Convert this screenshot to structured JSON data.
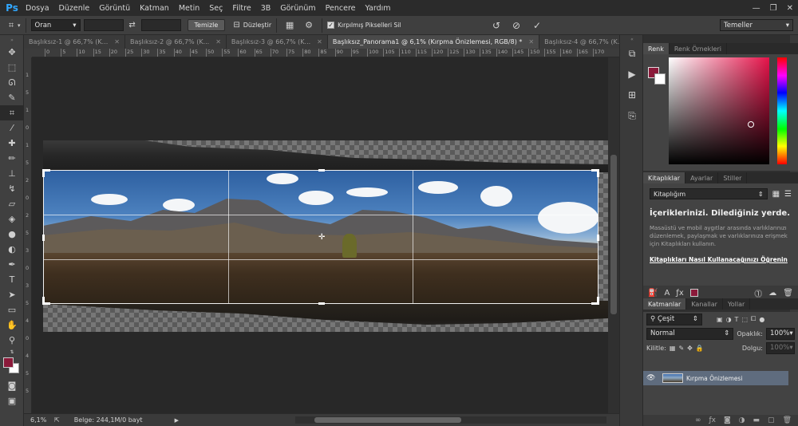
{
  "app": {
    "logo": "Ps",
    "menu": [
      "Dosya",
      "Düzenle",
      "Görüntü",
      "Katman",
      "Metin",
      "Seç",
      "Filtre",
      "3B",
      "Görünüm",
      "Pencere",
      "Yardım"
    ],
    "window_controls": [
      "—",
      "❐",
      "✕"
    ]
  },
  "options_bar": {
    "ratio_dropdown": "Oran",
    "clear_button": "Temizle",
    "straighten_label": "Düzleştir",
    "delete_cropped_label": "Kırpılmış Pikselleri Sil",
    "delete_cropped_checked": true,
    "workspace_dropdown": "Temeller"
  },
  "doc_tabs": [
    {
      "label": "Başlıksız-1 @ 66,7% (K...",
      "active": false
    },
    {
      "label": "Başlıksız-2 @ 66,7% (K...",
      "active": false
    },
    {
      "label": "Başlıksız-3 @ 66,7% (K...",
      "active": false
    },
    {
      "label": "Başlıksız_Panorama1 @ 6,1% (Kırpma Önizlemesi, RGB/8) *",
      "active": true
    },
    {
      "label": "Başlıksız-4 @ 66,7% (K...",
      "active": false
    }
  ],
  "rulers": {
    "top_ticks": [
      "0",
      "5",
      "10",
      "15",
      "20",
      "25",
      "30",
      "35",
      "40",
      "45",
      "50",
      "55",
      "60",
      "65",
      "70",
      "75",
      "80",
      "85",
      "90",
      "95",
      "100",
      "105",
      "110",
      "115",
      "120",
      "125",
      "130",
      "135",
      "140",
      "145",
      "150",
      "155",
      "160",
      "165",
      "170"
    ],
    "left_ticks": [
      "1",
      "5",
      "1",
      "0",
      "1",
      "5",
      "2",
      "0",
      "2",
      "5",
      "3",
      "0",
      "3",
      "5",
      "4",
      "0",
      "4",
      "5",
      "5"
    ]
  },
  "status": {
    "zoom": "6,1%",
    "doc_info": "Belge: 244,1M/0 bayt"
  },
  "color_panel": {
    "tabs": [
      "Renk",
      "Renk Örnekleri"
    ],
    "foreground": "#8b1a3a",
    "background": "#ffffff"
  },
  "library_panel": {
    "tabs": [
      "Kitaplıklar",
      "Ayarlar",
      "Stiller"
    ],
    "select": "Kitaplığım",
    "title": "İçeriklerinizi. Dilediğiniz yerde.",
    "description": "Masaüstü ve mobil aygıtlar arasında varlıklarınızı düzenlemek, paylaşmak ve varlıklarınıza erişmek için Kitaplıkları kullanın.",
    "link": "Kitaplıkları Nasıl Kullanacağınızı Öğrenin"
  },
  "layers_panel": {
    "tabs": [
      "Katmanlar",
      "Kanallar",
      "Yollar"
    ],
    "filter": "Çeşit",
    "blend_mode": "Normal",
    "opacity_label": "Opaklık:",
    "opacity_value": "100%",
    "lock_label": "Kilitle:",
    "fill_label": "Dolgu:",
    "fill_value": "100%",
    "layers": [
      {
        "name": "Kırpma Önizlemesi",
        "visible": true
      }
    ]
  }
}
